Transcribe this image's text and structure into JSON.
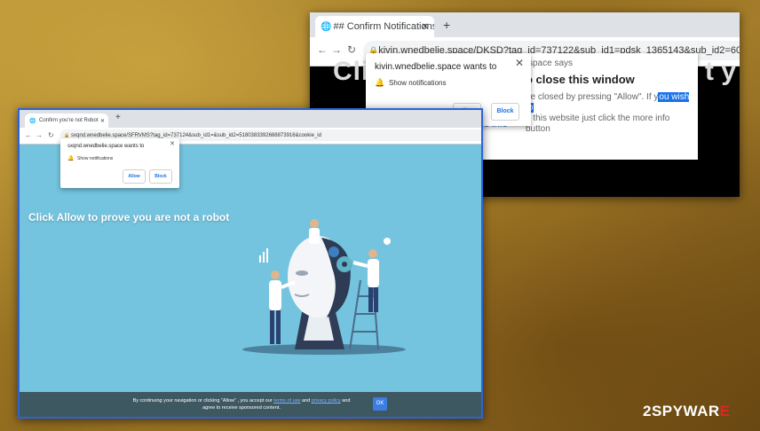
{
  "back_window": {
    "tab_title": "## Confirm Notifications ##",
    "url": "kivin.wnedbelie.space/DKSD?tag_id=737122&sub_id1=pdsk_1365143&sub_id2=6013579987572605459&cookie_",
    "big_text_left": "Clic",
    "big_text_right": "t y",
    "dialog": {
      "origin": "space says",
      "title": "o close this window",
      "body_line1": "be closed by pressing \"Allow\". If y",
      "body_highlight": "ou wish to",
      "body_line2": "g this website just click the more info button",
      "more_info": "More info"
    },
    "permission": {
      "title": "kivin.wnedbelie.space wants to",
      "row": "Show notifications",
      "allow": "Allow",
      "block": "Block"
    }
  },
  "front_window": {
    "tab_title": "Confirm you're not Robot",
    "url": "sxqnd.wnedbelie.space/SFRVMS?tag_id=737124&sub_id1=&sub_id2=5180383392688873916&cookie_id",
    "permission": {
      "title": "sxqnd.wnedbelie.space wants to",
      "row": "Show notifications",
      "allow": "Allow",
      "block": "Block"
    },
    "headline": "Click Allow to prove you are not a robot",
    "footer": {
      "text_part1": "By continuing your navigation or clicking  \"Allow\" , you accept our",
      "link1": "terms of use",
      "text_and": "and",
      "link2": "privacy policy",
      "text_part2": "and",
      "text_line2": "agree to receive sponsored content.",
      "ok_label": "OK"
    }
  },
  "watermark": {
    "part1": "2SPYWAR",
    "part2": "E"
  }
}
